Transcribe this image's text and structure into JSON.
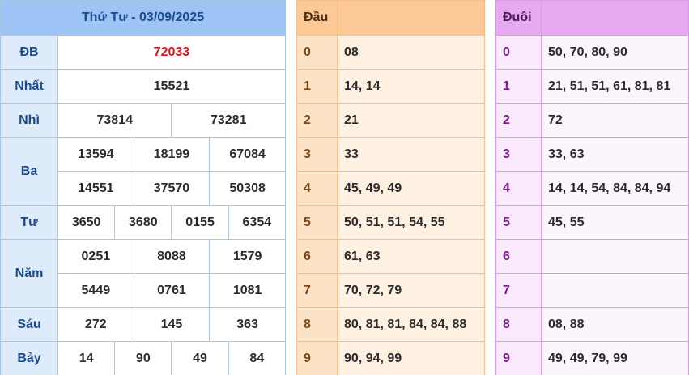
{
  "results": {
    "title": "Thứ Tư - 03/09/2025",
    "db_label": "ĐB",
    "db": "72033",
    "nhat_label": "Nhất",
    "nhat": "15521",
    "nhi_label": "Nhì",
    "nhi": [
      "73814",
      "73281"
    ],
    "ba_label": "Ba",
    "ba": [
      "13594",
      "18199",
      "67084",
      "14551",
      "37570",
      "50308"
    ],
    "tu_label": "Tư",
    "tu": [
      "3650",
      "3680",
      "0155",
      "6354"
    ],
    "nam_label": "Năm",
    "nam": [
      "0251",
      "8088",
      "1579",
      "5449",
      "0761",
      "1081"
    ],
    "sau_label": "Sáu",
    "sau": [
      "272",
      "145",
      "363"
    ],
    "bay_label": "Bảy",
    "bay": [
      "14",
      "90",
      "49",
      "84"
    ]
  },
  "dau": {
    "title": "Đầu",
    "keys": [
      "0",
      "1",
      "2",
      "3",
      "4",
      "5",
      "6",
      "7",
      "8",
      "9"
    ],
    "values": [
      "08",
      "14, 14",
      "21",
      "33",
      "45, 49, 49",
      "50, 51, 51, 54, 55",
      "61, 63",
      "70, 72, 79",
      "80, 81, 81, 84, 84, 88",
      "90, 94, 99"
    ]
  },
  "duoi": {
    "title": "Đuôi",
    "keys": [
      "0",
      "1",
      "2",
      "3",
      "4",
      "5",
      "6",
      "7",
      "8",
      "9"
    ],
    "values": [
      "50, 70, 80, 90",
      "21, 51, 51, 61, 81, 81",
      "72",
      "33, 63",
      "14, 14, 54, 84, 84, 94",
      "45, 55",
      "",
      "",
      "08, 88",
      "49, 49, 79, 99"
    ]
  }
}
